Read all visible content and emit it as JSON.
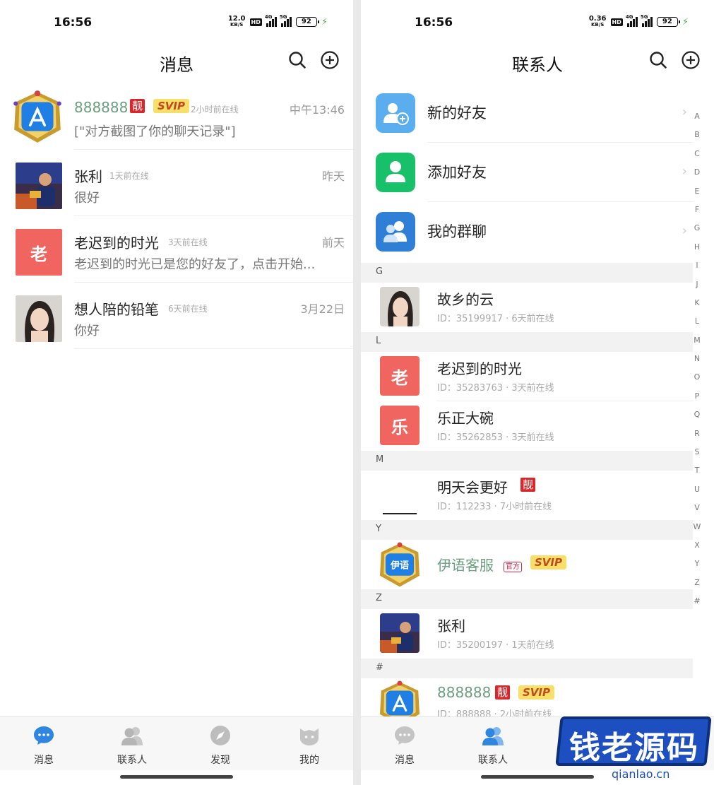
{
  "left": {
    "status": {
      "time": "16:56",
      "speed": "12.0",
      "speed_unit": "KB/S",
      "hd": "HD",
      "net1": "4G",
      "net2": "5G",
      "battery": "92"
    },
    "header": {
      "title": "消息"
    },
    "messages": [
      {
        "name": "888888",
        "badge_liang": "靓",
        "badge_svip": "SVIP",
        "online": "2小时前在线",
        "time": "中午13:46",
        "preview": "[\"对方截图了你的聊天记录\"]"
      },
      {
        "name": "张利",
        "online": "1天前在线",
        "time": "昨天",
        "preview": "很好"
      },
      {
        "name": "老迟到的时光",
        "avatar_text": "老",
        "online": "3天前在线",
        "time": "前天",
        "preview": "老迟到的时光已是您的好友了，点击开始..."
      },
      {
        "name": "想人陪的铅笔",
        "online": "6天前在线",
        "time": "3月22日",
        "preview": "你好"
      }
    ],
    "tabs": [
      {
        "label": "消息",
        "icon": "chat-bubble-icon",
        "active": true
      },
      {
        "label": "联系人",
        "icon": "contacts-icon",
        "active": false
      },
      {
        "label": "发现",
        "icon": "compass-icon",
        "active": false
      },
      {
        "label": "我的",
        "icon": "profile-icon",
        "active": false
      }
    ]
  },
  "right": {
    "status": {
      "time": "16:56",
      "speed": "0.36",
      "speed_unit": "KB/S",
      "hd": "HD",
      "net1": "4G",
      "net2": "5G",
      "battery": "92"
    },
    "header": {
      "title": "联系人"
    },
    "functions": [
      {
        "label": "新的好友",
        "icon": "new-friend-icon",
        "color": "#5aaef0"
      },
      {
        "label": "添加好友",
        "icon": "add-friend-icon",
        "color": "#17c069"
      },
      {
        "label": "我的群聊",
        "icon": "group-chat-icon",
        "color": "#2f7fd6"
      }
    ],
    "sections": [
      {
        "letter": "G",
        "contacts": [
          {
            "name": "故乡的云",
            "sub": "ID：35199917 · 6天前在线"
          }
        ]
      },
      {
        "letter": "L",
        "contacts": [
          {
            "name": "老迟到的时光",
            "avatar_text": "老",
            "sub": "ID：35283763 · 3天前在线"
          },
          {
            "name": "乐正大碗",
            "avatar_text": "乐",
            "sub": "ID：35262853 · 3天前在线"
          }
        ]
      },
      {
        "letter": "M",
        "contacts": [
          {
            "name": "明天会更好",
            "badge_liang": "靓",
            "sub": "ID：112233 · 7小时前在线"
          }
        ]
      },
      {
        "letter": "Y",
        "contacts": [
          {
            "name": "伊语客服",
            "badge_official": "官方",
            "badge_svip": "SVIP"
          }
        ]
      },
      {
        "letter": "Z",
        "contacts": [
          {
            "name": "张利",
            "sub": "ID：35200197 · 1天前在线"
          }
        ]
      },
      {
        "letter": "#",
        "contacts": [
          {
            "name": "888888",
            "badge_liang": "靓",
            "badge_svip": "SVIP",
            "sub": "ID：888888 · 2小时前在线"
          }
        ]
      }
    ],
    "index": [
      "A",
      "B",
      "C",
      "D",
      "E",
      "F",
      "G",
      "H",
      "I",
      "J",
      "K",
      "L",
      "M",
      "N",
      "O",
      "P",
      "Q",
      "R",
      "S",
      "T",
      "U",
      "V",
      "W",
      "X",
      "Y",
      "Z",
      "#"
    ],
    "tabs": [
      {
        "label": "消息",
        "icon": "chat-bubble-icon",
        "active": false
      },
      {
        "label": "联系人",
        "icon": "contacts-icon",
        "active": true
      }
    ]
  },
  "watermark": {
    "text": "钱老源码",
    "url": "qianlao.cn"
  },
  "colors": {
    "accent": "#2f86e0",
    "vip_name": "#6a9e7e",
    "red_badge": "#d9262b",
    "svip_bg": "#f8df6a"
  }
}
